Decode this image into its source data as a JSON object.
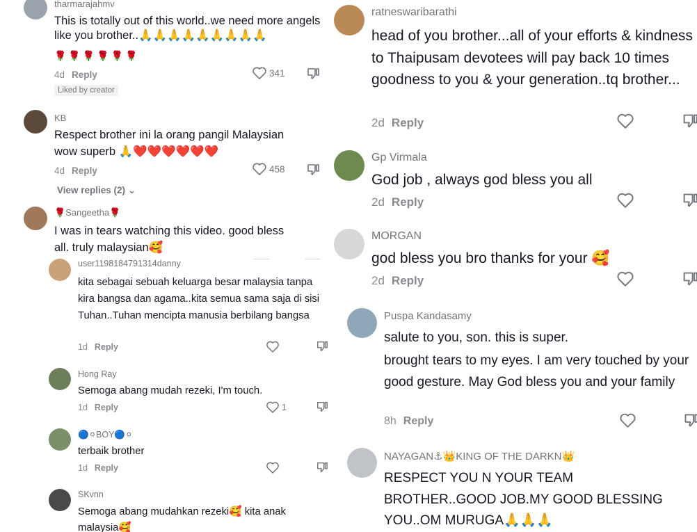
{
  "panel1": {
    "comments": [
      {
        "user": "tharmarajahmv",
        "text": "This is totally out of this world..we need more angels like you brother..🙏🙏🙏🙏🙏🙏🙏🙏🙏",
        "emoji2": "🌹🌹🌹🌹🌹🌹",
        "time": "4d",
        "reply": "Reply",
        "likes": "341",
        "liked_by": "Liked by creator"
      },
      {
        "user": "KB",
        "text": "Respect brother ini la orang pangil Malaysian",
        "text2": "wow superb 🙏❤️❤️❤️❤️❤️❤️",
        "time": "4d",
        "reply": "Reply",
        "likes": "458",
        "view_replies": "View replies (2)"
      },
      {
        "user": "🌹Sangeetha🌹",
        "text": "I was in tears watching this video. good bless",
        "text2": "all. truly malaysian🥰"
      }
    ]
  },
  "panel2": {
    "comments": [
      {
        "user": "user1198184791314danny",
        "text": "kita sebagai sebuah keluarga besar malaysia tanpa kira bangsa dan agama..kita semua sama saja di sisi Tuhan..Tuhan mencipta manusia berbilang bangsa",
        "time": "1d",
        "reply": "Reply"
      },
      {
        "user": "Hong Ray",
        "text": "Semoga abang mudah rezeki, I'm touch.",
        "time": "1d",
        "reply": "Reply",
        "likes": "1"
      },
      {
        "user": "🔵⚪BOY🔵⚪",
        "text": "terbaik brother",
        "time": "1d",
        "reply": "Reply"
      },
      {
        "user": "SKvnn",
        "text": "Semoga abang mudahkan rezeki🥰 kita anak",
        "text2": "malaysia🥰"
      }
    ]
  },
  "panel3": {
    "comments": [
      {
        "user": "ratneswaribarathi",
        "text": "head of you brother...all of your efforts & kindness to Thaipusam devotees will pay back 10 times goodness to you & your generation..tq brother...",
        "time": "2d",
        "reply": "Reply"
      },
      {
        "user": "Gp Virmala",
        "text": "God job , always god bless you all",
        "time": "2d",
        "reply": "Reply"
      },
      {
        "user": "MORGAN",
        "text": "god bless you bro thanks for your 🥰",
        "time": "2d",
        "reply": "Reply"
      }
    ]
  },
  "panel4": {
    "comments": [
      {
        "user": "Puspa Kandasamy",
        "text": "salute to you, son. this is super.",
        "text2": "brought tears to my eyes. I am very touched by your good gesture. May God bless you and your family",
        "time": "8h",
        "reply": "Reply"
      },
      {
        "user": "NAYAGAN⚓👑KING OF THE DARKN👑",
        "text": "RESPECT YOU N YOUR TEAM BROTHER..GOOD JOB.MY GOOD BLESSING YOU..OM MURUGA🙏🙏🙏"
      }
    ]
  },
  "colors": {
    "avatar_palette": [
      "#9aa3ab",
      "#5b4a3a",
      "#a0785a",
      "#c9a27a",
      "#6d7f5a",
      "#8d8d8d",
      "#7a8f6a",
      "#4a4a4a",
      "#b98a55",
      "#6e8a4f",
      "#d7d7d7",
      "#8fa7b8",
      "#c0c4c8"
    ]
  }
}
